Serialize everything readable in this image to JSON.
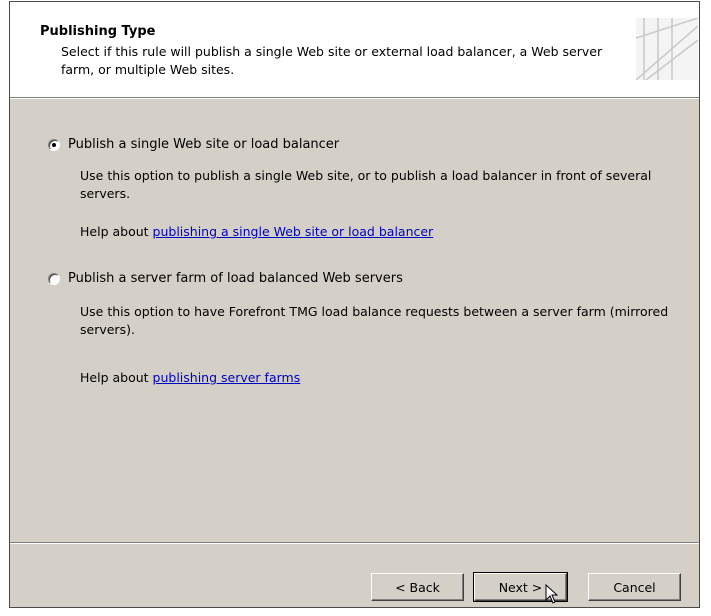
{
  "header": {
    "title": "Publishing Type",
    "description": "Select if this rule will publish a single Web site or external load balancer, a Web server farm, or multiple Web sites."
  },
  "options": [
    {
      "label": "Publish a single Web site or load balancer",
      "checked": true,
      "description": "Use this option to publish a single Web site, or to publish a load balancer in front of several servers.",
      "help_prefix": "Help about",
      "help_link": "publishing a single Web site or load balancer"
    },
    {
      "label": "Publish a server farm of load balanced Web servers",
      "checked": false,
      "description": "Use this option to have Forefront TMG load balance requests between a server farm (mirrored servers).",
      "help_prefix": "Help about",
      "help_link": "publishing server farms"
    }
  ],
  "buttons": {
    "back": "< Back",
    "next": "Next >",
    "cancel": "Cancel"
  }
}
